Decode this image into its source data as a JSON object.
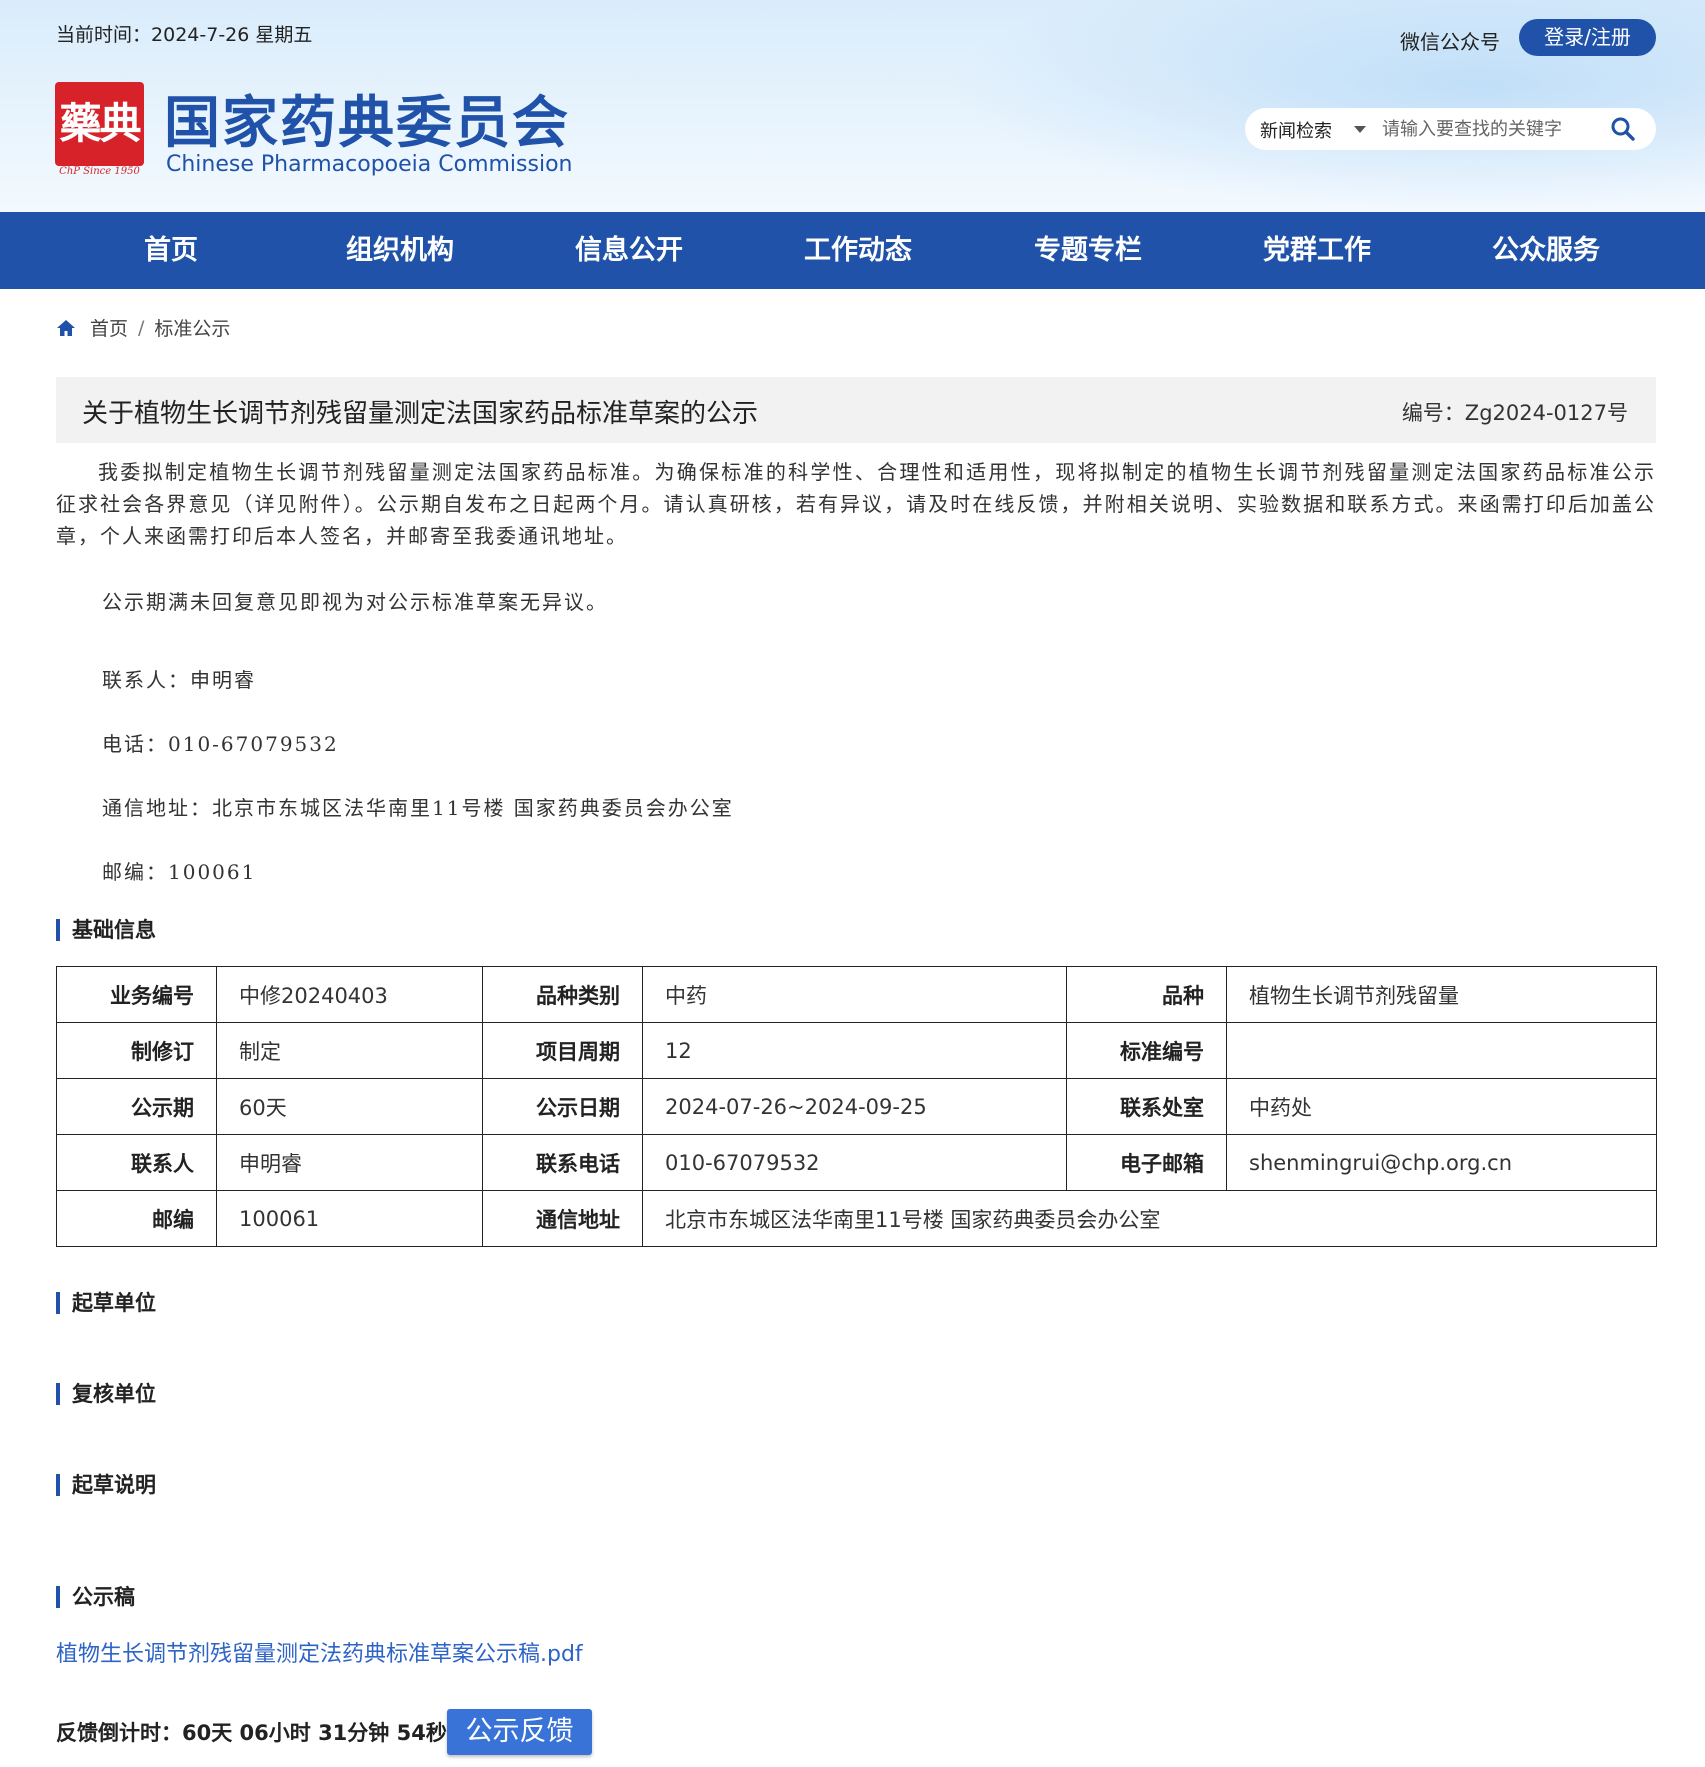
{
  "header": {
    "current_time_label": "当前时间：",
    "current_time": "2024-7-26 星期五",
    "wechat_label": "微信公众号",
    "login_label": "登录/注册",
    "logo_seal_text": "藥典",
    "logo_since": "ChP Since 1950",
    "site_name_cn": "国家药典委员会",
    "site_name_en": "Chinese Pharmacopoeia Commission",
    "search": {
      "type_label": "新闻检索",
      "placeholder": "请输入要查找的关键字"
    }
  },
  "nav": {
    "items": [
      {
        "label": "首页"
      },
      {
        "label": "组织机构"
      },
      {
        "label": "信息公开"
      },
      {
        "label": "工作动态"
      },
      {
        "label": "专题专栏"
      },
      {
        "label": "党群工作"
      },
      {
        "label": "公众服务"
      }
    ]
  },
  "breadcrumb": {
    "home": "首页",
    "separator": "/",
    "current": "标准公示"
  },
  "article": {
    "title": "关于植物生长调节剂残留量测定法国家药品标准草案的公示",
    "number": "编号：Zg2024-0127号",
    "paragraph1": "我委拟制定植物生长调节剂残留量测定法国家药品标准。为确保标准的科学性、合理性和适用性，现将拟制定的植物生长调节剂残留量测定法国家药品标准公示征求社会各界意见（详见附件）。公示期自发布之日起两个月。请认真研核，若有异议，请及时在线反馈，并附相关说明、实验数据和联系方式。来函需打印后加盖公章，个人来函需打印后本人签名，并邮寄至我委通讯地址。",
    "paragraph2": "公示期满未回复意见即视为对公示标准草案无异议。",
    "contact_person": "联系人：申明睿",
    "phone": "电话：010-67079532",
    "address": "通信地址：北京市东城区法华南里11号楼  国家药典委员会办公室",
    "postcode": "邮编：100061"
  },
  "sections": {
    "basic_info": "基础信息",
    "drafting_unit": "起草单位",
    "review_unit": "复核单位",
    "drafting_notes": "起草说明",
    "draft": "公示稿"
  },
  "info_table": {
    "rows": [
      {
        "l1": "业务编号",
        "v1": "中修20240403",
        "l2": "品种类别",
        "v2": "中药",
        "l3": "品种",
        "v3": "植物生长调节剂残留量"
      },
      {
        "l1": "制修订",
        "v1": "制定",
        "l2": "项目周期",
        "v2": "12",
        "l3": "标准编号",
        "v3": ""
      },
      {
        "l1": "公示期",
        "v1": "60天",
        "l2": "公示日期",
        "v2": "2024-07-26~2024-09-25",
        "l3": "联系处室",
        "v3": "中药处"
      },
      {
        "l1": "联系人",
        "v1": "申明睿",
        "l2": "联系电话",
        "v2": "010-67079532",
        "l3": "电子邮箱",
        "v3": "shenmingrui@chp.org.cn"
      },
      {
        "l1": "邮编",
        "v1": "100061",
        "l2": "通信地址",
        "v2": "北京市东城区法华南里11号楼 国家药典委员会办公室"
      }
    ]
  },
  "attachment": {
    "pdf_name": "植物生长调节剂残留量测定法药典标准草案公示稿.pdf"
  },
  "feedback": {
    "countdown_label": "反馈倒计时：",
    "countdown_value": "60天 06小时 31分钟 54秒",
    "button_label": "公示反馈"
  },
  "colors": {
    "brand_blue": "#1f52a8",
    "seal_red": "#d82229",
    "link_blue": "#2e63c8",
    "button_blue": "#3a73d7"
  }
}
